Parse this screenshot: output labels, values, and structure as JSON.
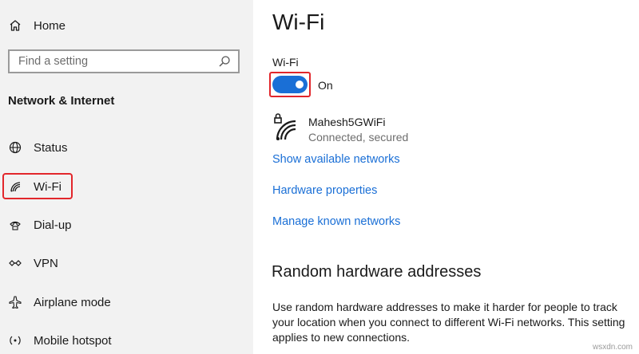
{
  "sidebar": {
    "home_label": "Home",
    "search": {
      "placeholder": "Find a setting"
    },
    "section_title": "Network & Internet",
    "items": [
      {
        "label": "Status",
        "icon": "globe-icon"
      },
      {
        "label": "Wi-Fi",
        "icon": "wifi-icon",
        "selected": true
      },
      {
        "label": "Dial-up",
        "icon": "phone-icon"
      },
      {
        "label": "VPN",
        "icon": "vpn-icon"
      },
      {
        "label": "Airplane mode",
        "icon": "airplane-icon"
      },
      {
        "label": "Mobile hotspot",
        "icon": "hotspot-icon"
      }
    ]
  },
  "main": {
    "title": "Wi-Fi",
    "wifi_toggle": {
      "label": "Wi-Fi",
      "state_text": "On",
      "on": true
    },
    "network": {
      "name": "Mahesh5GWiFi",
      "status": "Connected, secured",
      "icon": "secured-wifi-icon"
    },
    "links": [
      "Show available networks",
      "Hardware properties",
      "Manage known networks"
    ],
    "random_hw": {
      "title": "Random hardware addresses",
      "description": "Use random hardware addresses to make it harder for people to track your location when you connect to different Wi-Fi networks. This setting applies to new connections."
    }
  },
  "watermark": "wsxdn.com",
  "colors": {
    "accent": "#1a6fd6",
    "highlight": "#e2262b",
    "sidebar_bg": "#f2f2f2"
  }
}
